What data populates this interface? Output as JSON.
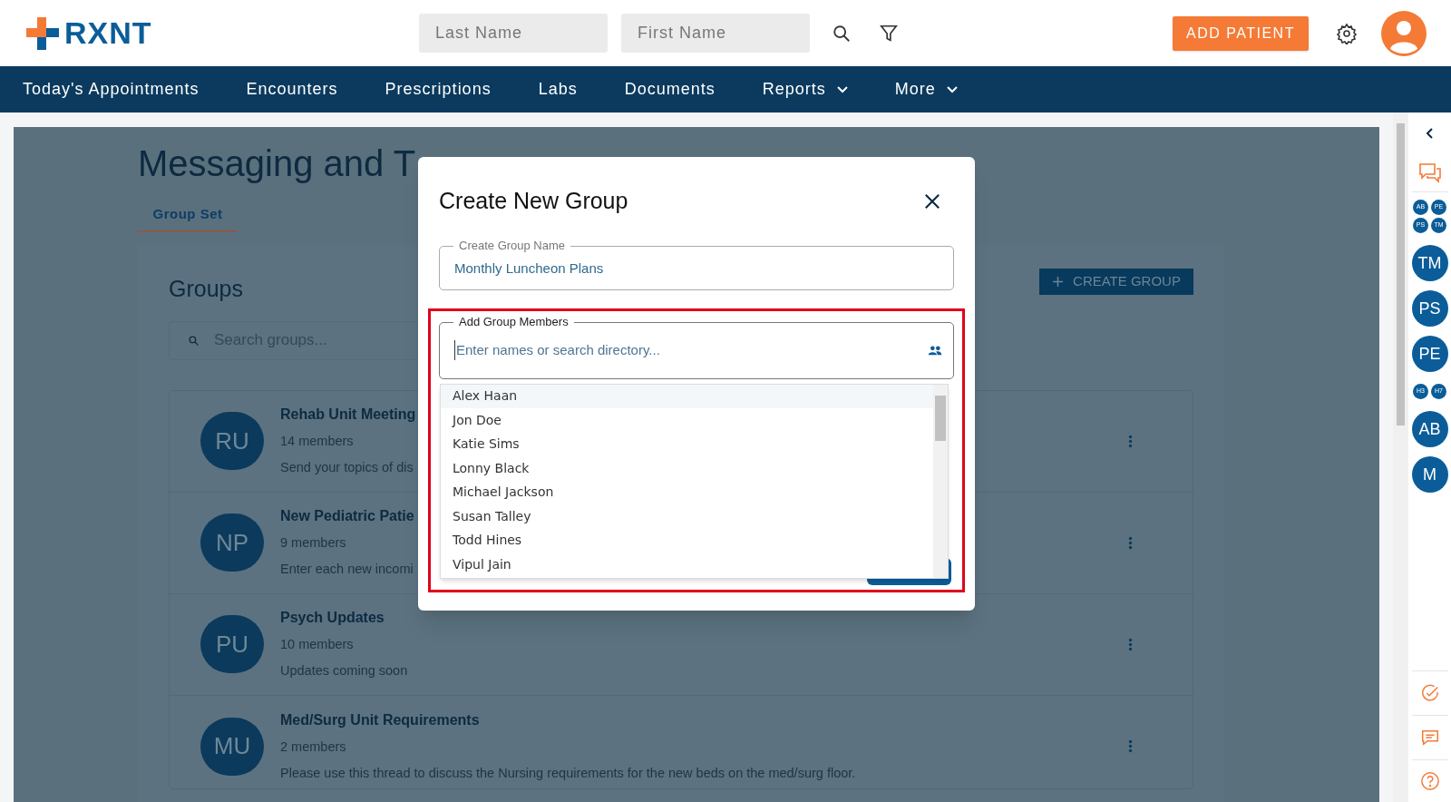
{
  "header": {
    "logo": "RXNT",
    "search_fields": [
      {
        "placeholder": "Last Name"
      },
      {
        "placeholder": "First Name"
      }
    ],
    "add_button": "ADD PATIENT"
  },
  "nav": [
    {
      "label": "Today's Appointments",
      "dropdown": false
    },
    {
      "label": "Encounters",
      "dropdown": false
    },
    {
      "label": "Prescriptions",
      "dropdown": false
    },
    {
      "label": "Labs",
      "dropdown": false
    },
    {
      "label": "Documents",
      "dropdown": false
    },
    {
      "label": "Reports",
      "dropdown": true
    },
    {
      "label": "More",
      "dropdown": true
    }
  ],
  "page": {
    "title": "Messaging and T",
    "tabs": [
      {
        "label": "Group Set",
        "selected": true
      }
    ],
    "groups_title": "Groups",
    "search_placeholder": "Search groups...",
    "create_button": "CREATE GROUP",
    "groups": [
      {
        "initials": "RU",
        "name": "Rehab Unit Meeting",
        "members": "14 members",
        "description": "Send your topics of dis"
      },
      {
        "initials": "NP",
        "name": "New Pediatric Patie",
        "members": "9 members",
        "description": "Enter each new incomi"
      },
      {
        "initials": "PU",
        "name": "Psych Updates",
        "members": "10 members",
        "description": "Updates coming soon"
      },
      {
        "initials": "MU",
        "name": "Med/Surg Unit Requirements",
        "members": "2 members",
        "description": "Please use this thread to discuss the Nursing requirements for the new beds on the med/surg floor."
      }
    ]
  },
  "dialog": {
    "title": "Create New Group",
    "name_field": {
      "label": "Create Group Name",
      "value": "Monthly Luncheon Plans"
    },
    "members_field": {
      "label": "Add Group Members",
      "placeholder": "Enter names or search directory..."
    },
    "options": [
      {
        "name": "Alex Haan",
        "selected": true
      },
      {
        "name": "Jon Doe",
        "selected": false
      },
      {
        "name": "Katie Sims",
        "selected": false
      },
      {
        "name": "Lonny Black",
        "selected": false
      },
      {
        "name": "Michael Jackson",
        "selected": false
      },
      {
        "name": "Susan Talley",
        "selected": false
      },
      {
        "name": "Todd Hines",
        "selected": false
      },
      {
        "name": "Vipul Jain",
        "selected": false
      }
    ]
  },
  "rail": [
    {
      "kind": "group",
      "initials": [
        "AB",
        "PE",
        "PS",
        "TM"
      ]
    },
    {
      "kind": "avatar",
      "initials": [
        "TM"
      ]
    },
    {
      "kind": "avatar",
      "initials": [
        "PS"
      ]
    },
    {
      "kind": "avatar",
      "initials": [
        "PE"
      ]
    },
    {
      "kind": "group",
      "initials": [
        "H3",
        "H7"
      ]
    },
    {
      "kind": "avatar",
      "initials": [
        "AB"
      ]
    },
    {
      "kind": "avatar",
      "initials": [
        "M"
      ]
    }
  ]
}
